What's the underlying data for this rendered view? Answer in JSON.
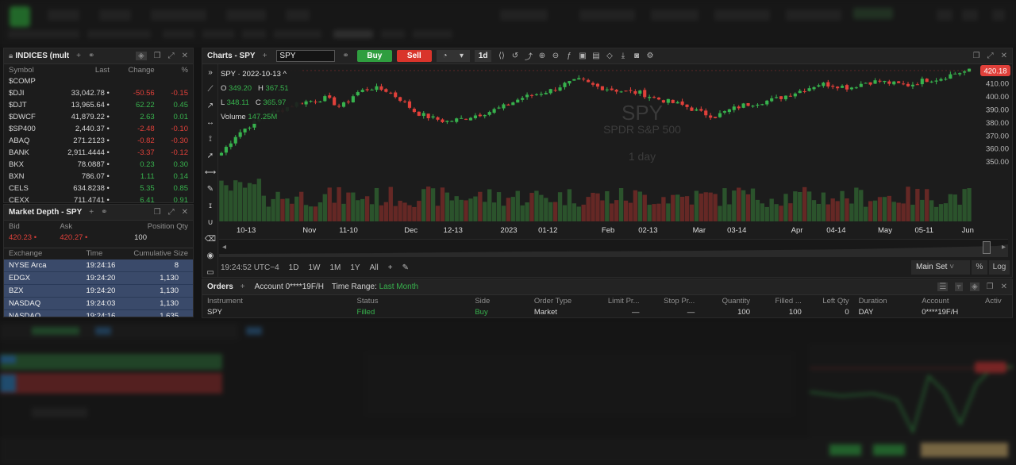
{
  "indices": {
    "title": "INDICES (mult",
    "columns": [
      "Symbol",
      "Last",
      "Change",
      "%"
    ],
    "rows": [
      {
        "symbol": "$COMP",
        "last": "",
        "change": "",
        "pct": "",
        "dir": "none"
      },
      {
        "symbol": "$DJI",
        "last": "33,042.78 •",
        "change": "-50.56",
        "pct": "-0.15",
        "dir": "down"
      },
      {
        "symbol": "$DJT",
        "last": "13,965.64 •",
        "change": "62.22",
        "pct": "0.45",
        "dir": "up"
      },
      {
        "symbol": "$DWCF",
        "last": "41,879.22 •",
        "change": "2.63",
        "pct": "0.01",
        "dir": "up"
      },
      {
        "symbol": "$SP400",
        "last": "2,440.37 •",
        "change": "-2.48",
        "pct": "-0.10",
        "dir": "down"
      },
      {
        "symbol": "ABAQ",
        "last": "271.2123 •",
        "change": "-0.82",
        "pct": "-0.30",
        "dir": "down"
      },
      {
        "symbol": "BANK",
        "last": "2,911.4444 •",
        "change": "-3.37",
        "pct": "-0.12",
        "dir": "down"
      },
      {
        "symbol": "BKX",
        "last": "78.0887 •",
        "change": "0.23",
        "pct": "0.30",
        "dir": "up"
      },
      {
        "symbol": "BXN",
        "last": "786.07 •",
        "change": "1.11",
        "pct": "0.14",
        "dir": "up"
      },
      {
        "symbol": "CELS",
        "last": "634.8238 •",
        "change": "5.35",
        "pct": "0.85",
        "dir": "up"
      },
      {
        "symbol": "CEXX",
        "last": "711.4741 •",
        "change": "6.41",
        "pct": "0.91",
        "dir": "up"
      }
    ]
  },
  "depth": {
    "title": "Market Depth - SPY",
    "labels": {
      "bid": "Bid",
      "ask": "Ask",
      "pos": "Position Qty"
    },
    "bid": "420.23 •",
    "ask": "420.27 •",
    "pos": "100",
    "columns": [
      "Exchange",
      "Time",
      "Cumulative Size"
    ],
    "rows": [
      {
        "exchange": "NYSE Arca",
        "time": "19:24:16",
        "size": "8"
      },
      {
        "exchange": "EDGX",
        "time": "19:24:20",
        "size": "1,130"
      },
      {
        "exchange": "BZX",
        "time": "19:24:20",
        "size": "1,130"
      },
      {
        "exchange": "NASDAQ",
        "time": "19:24:03",
        "size": "1,130"
      },
      {
        "exchange": "NASDAQ",
        "time": "19:24:16",
        "size": "1,635"
      }
    ]
  },
  "chart": {
    "title": "Charts - SPY",
    "symbol_input": "SPY",
    "buy_label": "Buy",
    "sell_label": "Sell",
    "period_label": "1d",
    "legend_title": "SPY · 2022-10-13 ^",
    "ohlc": {
      "o_label": "O",
      "o": "349.20",
      "h_label": "H",
      "h": "367.51",
      "l_label": "L",
      "l": "348.11",
      "c_label": "C",
      "c": "365.97"
    },
    "volume_label": "Volume",
    "volume_value": "147.25M",
    "watermark_symbol": "SPY",
    "watermark_name": "SPDR S&P 500",
    "watermark_period": "1 day",
    "time_readout": "19:24:52 UTC−4",
    "ranges": [
      "1D",
      "1W",
      "1M",
      "1Y",
      "All"
    ],
    "main_set_label": "Main Set",
    "pct_label": "%",
    "log_label": "Log",
    "colors": {
      "up": "#37b24d",
      "down": "#e0403a",
      "bg": "#1c1c1c"
    }
  },
  "chart_data": {
    "type": "candlestick",
    "x_tick_labels": [
      "10-13",
      "Nov",
      "11-10",
      "Dec",
      "12-13",
      "2023",
      "01-12",
      "Feb",
      "02-13",
      "Mar",
      "03-14",
      "Apr",
      "04-14",
      "May",
      "05-11",
      "Jun"
    ],
    "y_tick_labels": [
      "410.00",
      "400.00",
      "390.00",
      "380.00",
      "370.00",
      "360.00",
      "350.00"
    ],
    "ylim": [
      344,
      422
    ],
    "last_price": "420.18",
    "close_approx": [
      357,
      371,
      379,
      386,
      390,
      395,
      397,
      399,
      392,
      403,
      407,
      405,
      398,
      388,
      384,
      381,
      383,
      386,
      389,
      393,
      399,
      402,
      405,
      410,
      413,
      408,
      406,
      404,
      403,
      399,
      396,
      393,
      388,
      385,
      390,
      394,
      396,
      398,
      402,
      406,
      410,
      409,
      407,
      411,
      412,
      410,
      409,
      413,
      414,
      418,
      420
    ],
    "grid": false
  },
  "orders": {
    "title": "Orders",
    "account_label": "Account",
    "account_value": "0****19F/H",
    "range_label": "Time Range:",
    "range_value": "Last Month",
    "columns": [
      "Instrument",
      "Status",
      "Side",
      "Order Type",
      "Limit Pr...",
      "Stop Pr...",
      "Quantity",
      "Filled ...",
      "Left Qty",
      "Duration",
      "Account",
      "Activ"
    ],
    "row": {
      "instrument": "SPY",
      "status": "Filled",
      "side": "Buy",
      "type": "Market",
      "limit": "—",
      "stop": "—",
      "qty": "100",
      "filled": "100",
      "left": "0",
      "duration": "DAY",
      "account": "0****19F/H"
    }
  },
  "icons": [
    "lock-icon",
    "plus-icon",
    "link-icon",
    "expand-icon",
    "close-icon",
    "crosshair-icon",
    "trendline-icon",
    "eye-icon",
    "settings-icon"
  ]
}
